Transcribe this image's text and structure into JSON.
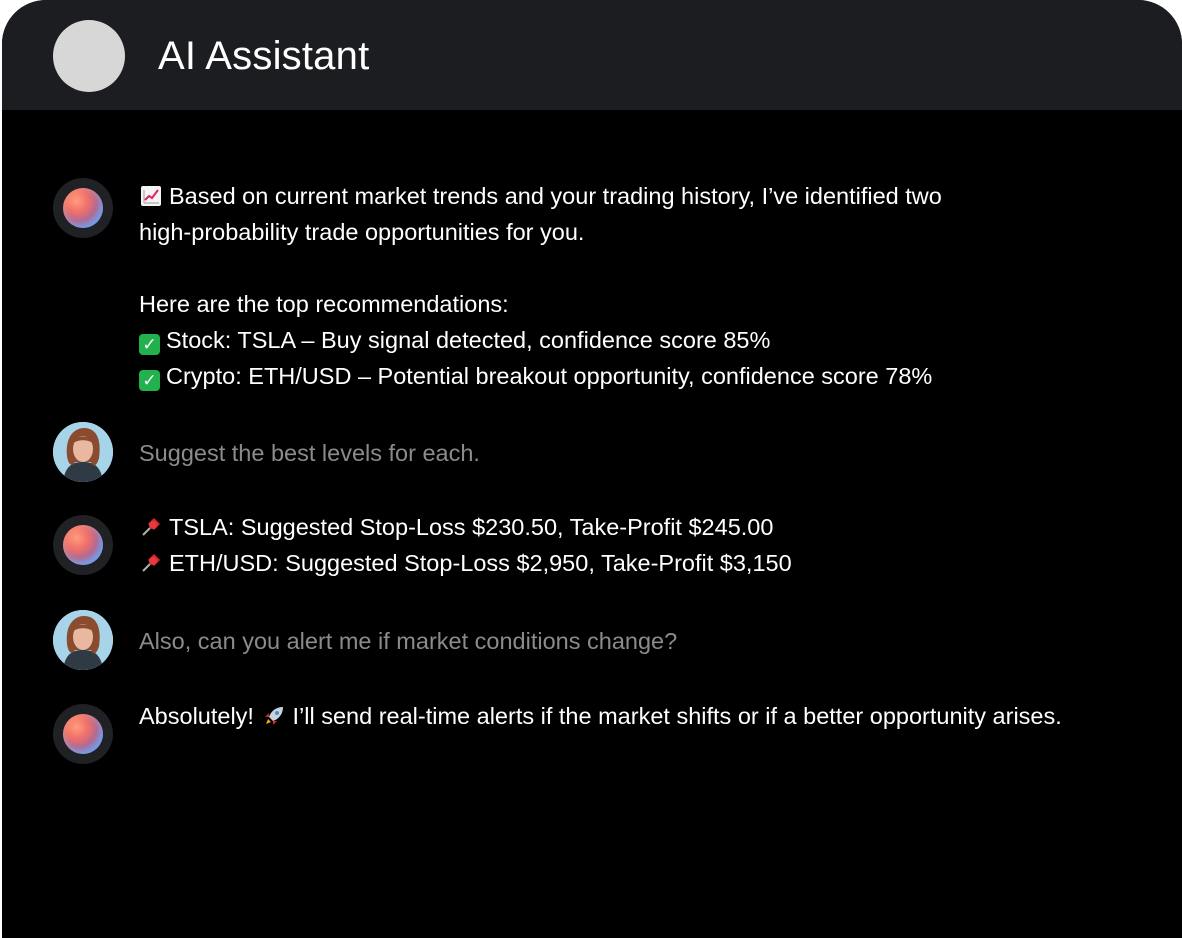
{
  "header": {
    "title": "AI Assistant"
  },
  "messages": [
    {
      "role": "assistant",
      "lines": [
        "Based on current market trends and your trading history, I’ve identified two",
        "high-probability trade opportunities for you.",
        "",
        "Here are the top recommendations:",
        "Stock: TSLA – Buy signal detected, confidence score 85%",
        "Crypto: ETH/USD – Potential breakout opportunity, confidence score 78%"
      ],
      "line_icons": [
        "chart-increasing-icon",
        "",
        "",
        "",
        "check-mark-icon",
        "check-mark-icon"
      ]
    },
    {
      "role": "user",
      "text": "Suggest the best levels for each."
    },
    {
      "role": "assistant",
      "lines": [
        "TSLA: Suggested Stop-Loss $230.50, Take-Profit $245.00",
        "ETH/USD: Suggested Stop-Loss $2,950, Take-Profit $3,150"
      ],
      "line_icons": [
        "pushpin-icon",
        "pushpin-icon"
      ]
    },
    {
      "role": "user",
      "text": "Also, can you alert me if market conditions change?"
    },
    {
      "role": "assistant",
      "text_before_icon": "Absolutely!",
      "text_after_icon": "I’ll send real-time alerts if the market shifts or if a better opportunity arises.",
      "icon": "rocket-icon"
    }
  ],
  "colors": {
    "background": "#000000",
    "header": "#1c1d21",
    "assistant_text": "#ffffff",
    "user_text": "#8b8b8b",
    "check": "#22b14c"
  }
}
